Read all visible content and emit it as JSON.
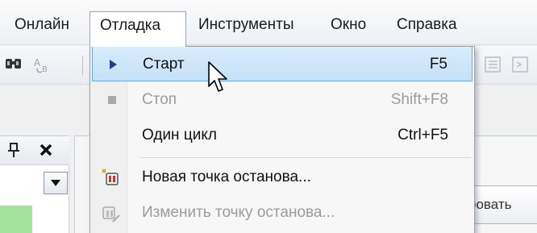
{
  "menubar": {
    "items": [
      {
        "label": "Онлайн"
      },
      {
        "label": "Отладка",
        "open": true
      },
      {
        "label": "Инструменты"
      },
      {
        "label": "Окно"
      },
      {
        "label": "Справка"
      }
    ]
  },
  "debug_menu": {
    "items": [
      {
        "label": "Старт",
        "shortcut": "F5",
        "icon": "play-icon",
        "state": "highlighted"
      },
      {
        "label": "Стоп",
        "shortcut": "Shift+F8",
        "icon": "stop-icon",
        "state": "disabled"
      },
      {
        "label": "Один цикл",
        "shortcut": "Ctrl+F5",
        "icon": "",
        "state": "enabled"
      },
      {
        "label": "Новая точка останова...",
        "shortcut": "",
        "icon": "new-breakpoint-icon",
        "state": "enabled"
      },
      {
        "label": "Изменить точку останова...",
        "shortcut": "",
        "icon": "edit-breakpoint-icon",
        "state": "disabled"
      }
    ]
  },
  "document": {
    "tab_label": "ровать"
  },
  "colors": {
    "highlight": "#c4e0f8",
    "highlight_border": "#6ea8e0",
    "play_arrow": "#1f3f8f",
    "status_green": "#a4e39b"
  }
}
